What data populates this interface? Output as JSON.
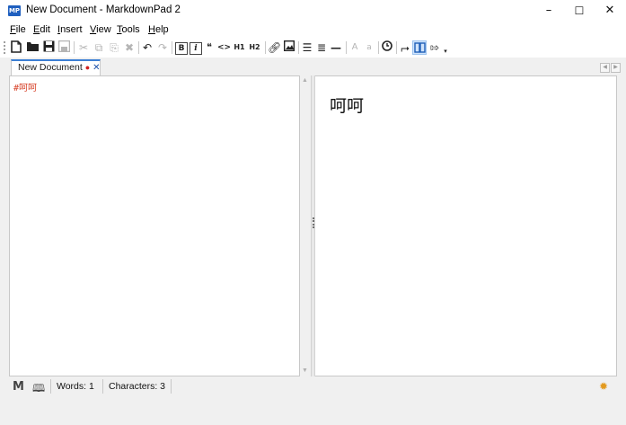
{
  "window": {
    "title": "New Document - MarkdownPad 2",
    "app_icon": "MP"
  },
  "controls": {
    "minimize": "–",
    "maximize": "☐",
    "close": "✕"
  },
  "menu": [
    {
      "u": "F",
      "rest": "ile"
    },
    {
      "u": "E",
      "rest": "dit"
    },
    {
      "u": "I",
      "rest": "nsert"
    },
    {
      "u": "V",
      "rest": "iew"
    },
    {
      "u": "T",
      "rest": "ools"
    },
    {
      "u": "H",
      "rest": "elp"
    }
  ],
  "toolbar": {
    "bold": "B",
    "italic": "i",
    "quote": "❝",
    "code": "<>",
    "h1": "H1",
    "h2": "H2",
    "font_up": "A",
    "font_down": "a",
    "more": "▾"
  },
  "tab": {
    "label": "New Document",
    "modified": "●",
    "close": "✕"
  },
  "editor": {
    "text": "#呵呵"
  },
  "preview": {
    "heading": "呵呵"
  },
  "status": {
    "words": "Words: 1",
    "characters": "Characters: 3"
  },
  "icons": {
    "new": "new-document-icon",
    "open": "open-folder-icon",
    "save": "save-icon",
    "markdown": "markdown-icon",
    "book": "book-icon",
    "settings": "settings-gear-icon"
  },
  "colors": {
    "accent": "#3c7fd4",
    "editor_text": "#d8452c",
    "gear": "#e39a1e"
  }
}
